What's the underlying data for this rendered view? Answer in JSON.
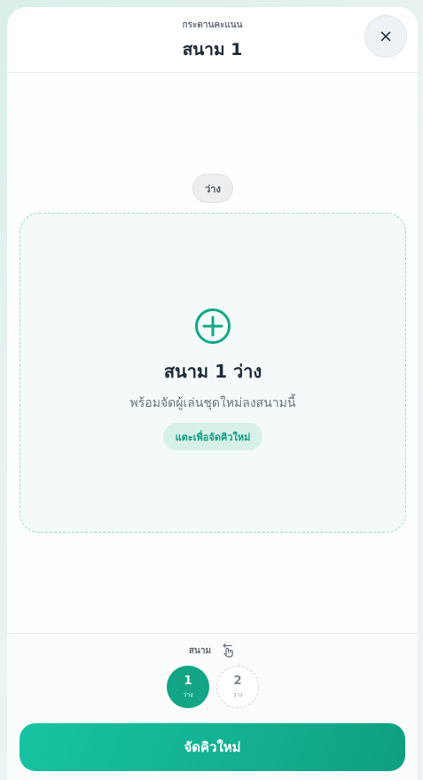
{
  "header": {
    "subtitle": "กระดานคะแนน",
    "title": "สนาม 1"
  },
  "status_pill": "ว่าง",
  "court_card": {
    "title": "สนาม 1 ว่าง",
    "description": "พร้อมจัดผู้เล่นชุดใหม่ลงสนามนี้",
    "tap_hint": "แตะเพื่อจัดคิวใหม่"
  },
  "footer": {
    "court_label": "สนาม",
    "courts": [
      {
        "number": "1",
        "status": "ว่าง"
      },
      {
        "number": "2",
        "status": "ว่าง"
      }
    ],
    "primary_button": "จัดคิวใหม่"
  },
  "colors": {
    "accent": "#13a585",
    "accent_light": "#d7f1ea",
    "card_border": "#9fd9c8",
    "text_dark": "#1e2a38"
  },
  "icons": {
    "close": "close-icon",
    "add": "plus-circle-icon",
    "swipe": "swipe-hand-icon"
  }
}
